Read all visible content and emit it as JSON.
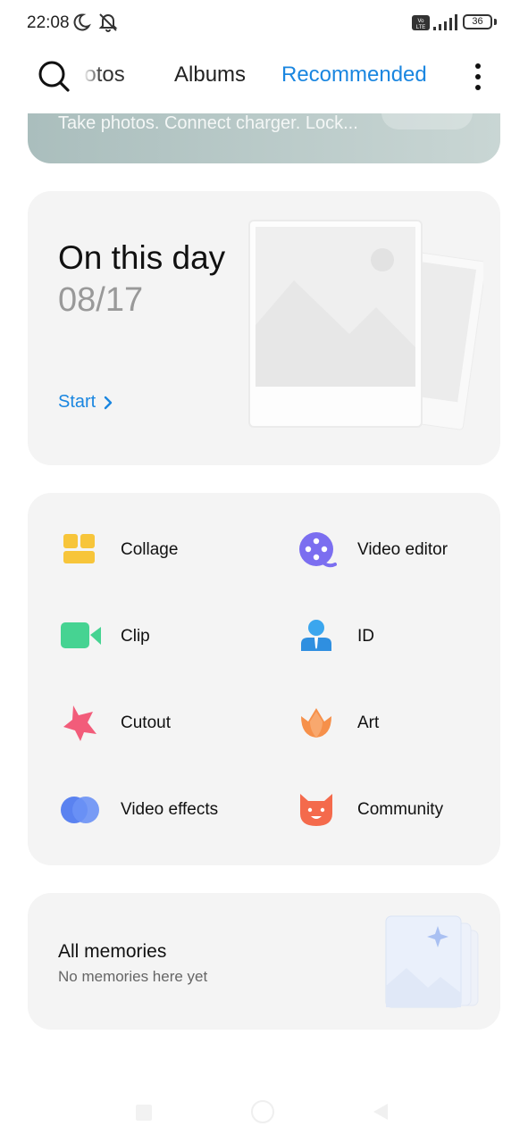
{
  "status_bar": {
    "time": "22:08",
    "battery": "36"
  },
  "tabs": [
    {
      "label": "hotos"
    },
    {
      "label": "Albums"
    },
    {
      "label": "Recommended"
    }
  ],
  "banner": {
    "text": "Take photos. Connect charger. Lock..."
  },
  "on_this_day": {
    "title": "On this day",
    "date": "08/17",
    "start_label": "Start"
  },
  "tools": [
    {
      "label": "Collage",
      "icon": "collage-icon"
    },
    {
      "label": "Video editor",
      "icon": "video-editor-icon"
    },
    {
      "label": "Clip",
      "icon": "clip-icon"
    },
    {
      "label": "ID",
      "icon": "id-icon"
    },
    {
      "label": "Cutout",
      "icon": "cutout-icon"
    },
    {
      "label": "Art",
      "icon": "art-icon"
    },
    {
      "label": "Video effects",
      "icon": "video-effects-icon"
    },
    {
      "label": "Community",
      "icon": "community-icon"
    }
  ],
  "memories": {
    "title": "All memories",
    "subtitle": "No memories here yet"
  },
  "colors": {
    "accent": "#1a86e0",
    "card_bg": "#f4f4f4"
  }
}
